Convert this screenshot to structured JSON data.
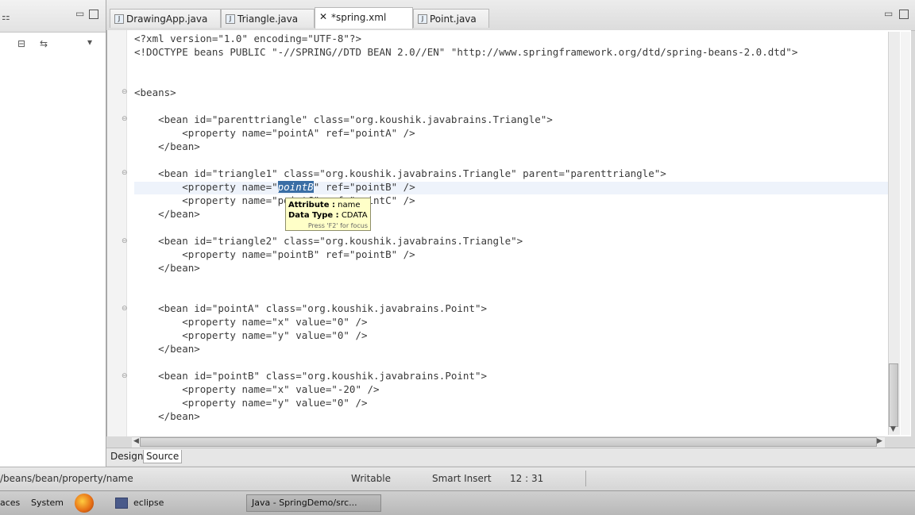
{
  "tabs": [
    {
      "label": "DrawingApp.java",
      "active": false
    },
    {
      "label": "Triangle.java",
      "active": false
    },
    {
      "label": "*spring.xml",
      "active": true
    },
    {
      "label": "Point.java",
      "active": false
    }
  ],
  "editor": {
    "lines": [
      {
        "text": "<?xml version=\"1.0\" encoding=\"UTF-8\"?>"
      },
      {
        "text": "<!DOCTYPE beans PUBLIC \"-//SPRING//DTD BEAN 2.0//EN\" \"http://www.springframework.org/dtd/spring-beans-2.0.dtd\">"
      },
      {
        "text": "<beans>"
      },
      {
        "text": "    <bean id=\"parenttriangle\" class=\"org.koushik.javabrains.Triangle\">"
      },
      {
        "text": "        <property name=\"pointA\" ref=\"pointA\" />"
      },
      {
        "text": "    </bean>"
      },
      {
        "text": "    <bean id=\"triangle1\" class=\"org.koushik.javabrains.Triangle\" parent=\"parenttriangle\">"
      },
      {
        "text_before": "        <property name=\"",
        "selected": "pointB",
        "text_after": "\" ref=\"pointB\" />"
      },
      {
        "text": "        <property name=\"pointC\" ref=\"pointC\" />"
      },
      {
        "text": "    </bean>"
      },
      {
        "text": "    <bean id=\"triangle2\" class=\"org.koushik.javabrains.Triangle\">"
      },
      {
        "text": "        <property name=\"pointB\" ref=\"pointB\" />"
      },
      {
        "text": "    </bean>"
      },
      {
        "text": "    <bean id=\"pointA\" class=\"org.koushik.javabrains.Point\">"
      },
      {
        "text": "        <property name=\"x\" value=\"0\" />"
      },
      {
        "text": "        <property name=\"y\" value=\"0\" />"
      },
      {
        "text": "    </bean>"
      },
      {
        "text": "    <bean id=\"pointB\" class=\"org.koushik.javabrains.Point\">"
      },
      {
        "text": "        <property name=\"x\" value=\"-20\" />"
      },
      {
        "text": "        <property name=\"y\" value=\"0\" />"
      },
      {
        "text": "    </bean>"
      }
    ]
  },
  "tooltip": {
    "attribute_label": "Attribute :",
    "attribute_value": "name",
    "datatype_label": "Data Type :",
    "datatype_value": "CDATA",
    "hint": "Press 'F2' for focus"
  },
  "editor_mode_tabs": {
    "design": "Design",
    "source": "Source"
  },
  "status": {
    "path": "/beans/bean/property/name",
    "writable": "Writable",
    "insert_mode": "Smart Insert",
    "position": "12 : 31"
  },
  "taskbar": {
    "places": "aces",
    "system": "System",
    "eclipse": "eclipse",
    "window": "Java - SpringDemo/src..."
  },
  "colors": {
    "attribute_value": "#2a00ff",
    "selection": "#3a6ea5",
    "tooltip_bg": "#ffffc8",
    "current_line": "#eef3fb"
  }
}
